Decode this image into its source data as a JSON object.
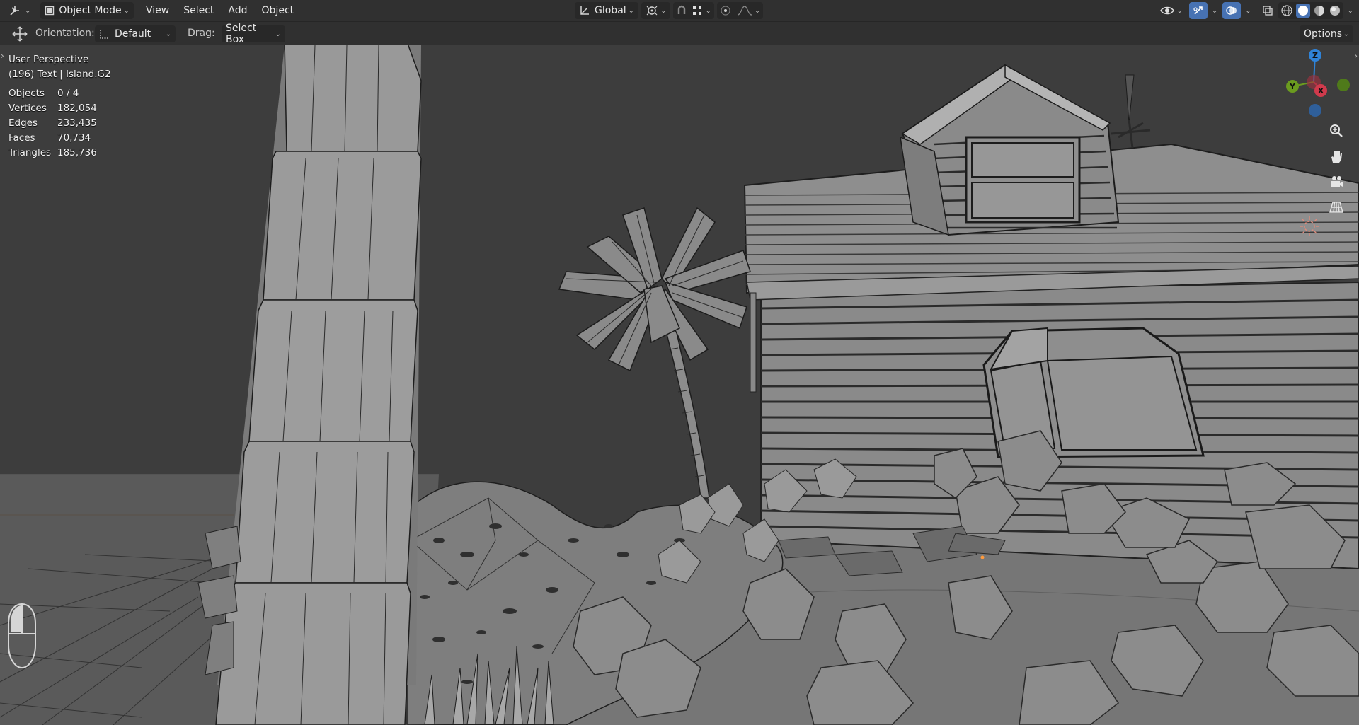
{
  "header": {
    "mode_label": "Object Mode",
    "menus": [
      "View",
      "Select",
      "Add",
      "Object"
    ],
    "transform_orientation": "Global",
    "options_label": "Options"
  },
  "toolbar": {
    "orientation_label": "Orientation:",
    "orientation_value": "Default",
    "drag_label": "Drag:",
    "drag_value": "Select Box",
    "options_label": "Options"
  },
  "viewport": {
    "view_name": "User Perspective",
    "active_info": "(196) Text | Island.G2",
    "stats": [
      {
        "label": "Objects",
        "value": "0 / 4"
      },
      {
        "label": "Vertices",
        "value": "182,054"
      },
      {
        "label": "Edges",
        "value": "233,435"
      },
      {
        "label": "Faces",
        "value": "70,734"
      },
      {
        "label": "Triangles",
        "value": "185,736"
      }
    ],
    "gizmo_axes": [
      "Z",
      "Y",
      "X"
    ]
  },
  "colors": {
    "accent": "#4772b3",
    "axis_x": "#d03a4c",
    "axis_y": "#6b9b1f",
    "axis_z": "#2f83d8"
  }
}
